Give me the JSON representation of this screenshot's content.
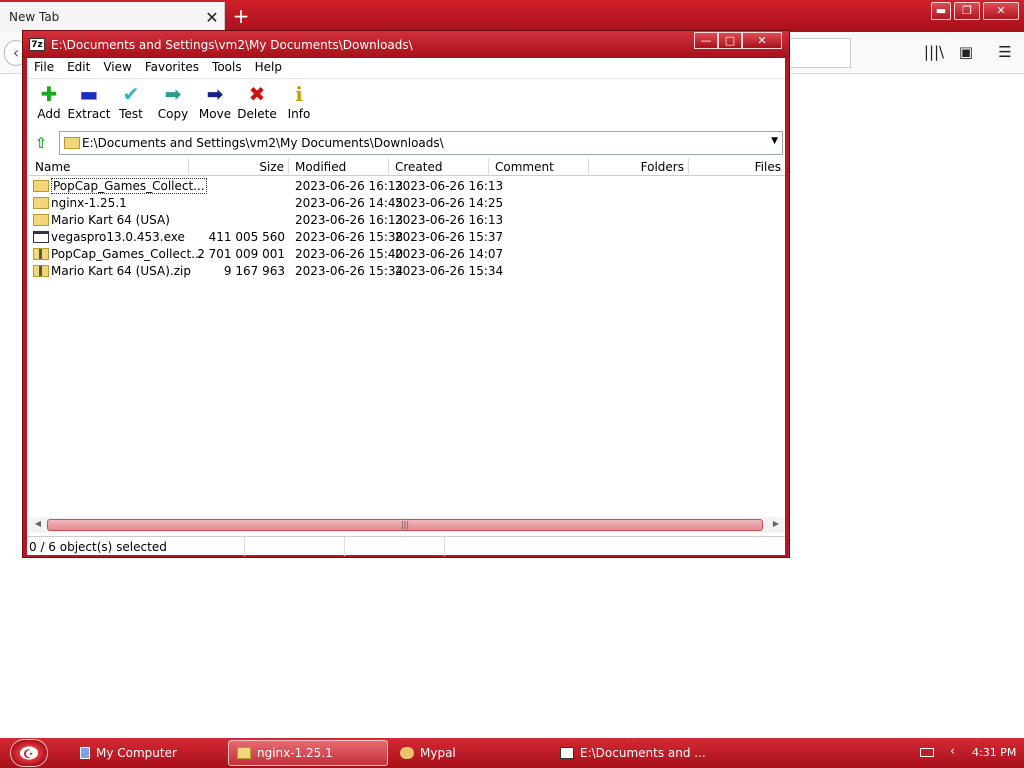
{
  "browser": {
    "tab_label": "New Tab",
    "tab_close": "✕",
    "new_tab": "+",
    "back": "‹",
    "controls": {
      "minimize": "▬",
      "restore": "❐",
      "close": "✕"
    },
    "toolbar_icons": {
      "library": "|||\\",
      "sidebar": "▣",
      "menu": "☰"
    }
  },
  "zip_window": {
    "title": "E:\\Documents and Settings\\vm2\\My Documents\\Downloads\\",
    "app_icon_text": "7z",
    "controls": {
      "minimize": "—",
      "maximize": "□",
      "close": "✕"
    },
    "menu": [
      "File",
      "Edit",
      "View",
      "Favorites",
      "Tools",
      "Help"
    ],
    "toolbar": [
      {
        "label": "Add",
        "icon": "plus-icon",
        "glyph": "✚",
        "color": "#1fa81f"
      },
      {
        "label": "Extract",
        "icon": "minus-icon",
        "glyph": "▬",
        "color": "#1a2fbf"
      },
      {
        "label": "Test",
        "icon": "check-icon",
        "glyph": "✔",
        "color": "#2ab5c8"
      },
      {
        "label": "Copy",
        "icon": "arrow-right-icon",
        "glyph": "➡",
        "color": "#2a9d8f"
      },
      {
        "label": "Move",
        "icon": "arrow-right-icon",
        "glyph": "➡",
        "color": "#1a1f8f"
      },
      {
        "label": "Delete",
        "icon": "x-icon",
        "glyph": "✖",
        "color": "#d01010"
      },
      {
        "label": "Info",
        "icon": "info-icon",
        "glyph": "i",
        "color": "#c8a000"
      }
    ],
    "address": "E:\\Documents and Settings\\vm2\\My Documents\\Downloads\\",
    "columns": [
      "Name",
      "Size",
      "Modified",
      "Created",
      "Comment",
      "Folders",
      "Files"
    ],
    "rows": [
      {
        "name": "PopCap_Games_Collect...",
        "type": "folder",
        "size": "",
        "modified": "2023-06-26 16:13",
        "created": "2023-06-26 16:13"
      },
      {
        "name": "nginx-1.25.1",
        "type": "folder",
        "size": "",
        "modified": "2023-06-26 14:45",
        "created": "2023-06-26 14:25"
      },
      {
        "name": "Mario Kart 64 (USA)",
        "type": "folder",
        "size": "",
        "modified": "2023-06-26 16:13",
        "created": "2023-06-26 16:13"
      },
      {
        "name": "vegaspro13.0.453.exe",
        "type": "exe",
        "size": "411 005 560",
        "modified": "2023-06-26 15:38",
        "created": "2023-06-26 15:37"
      },
      {
        "name": "PopCap_Games_Collect...",
        "type": "zip",
        "size": "2 701 009 001",
        "modified": "2023-06-26 15:40",
        "created": "2023-06-26 14:07"
      },
      {
        "name": "Mario Kart 64 (USA).zip",
        "type": "zip",
        "size": "9 167 963",
        "modified": "2023-06-26 15:34",
        "created": "2023-06-26 15:34"
      }
    ],
    "status": "0 / 6 object(s) selected"
  },
  "taskbar": {
    "items": [
      {
        "label": "My Computer",
        "active": false
      },
      {
        "label": "nginx-1.25.1",
        "active": true
      },
      {
        "label": "Mypal",
        "active": false
      },
      {
        "label": "E:\\Documents and ...",
        "active": false
      }
    ],
    "clock": "4:31 PM",
    "tray_chevron": "‹"
  }
}
